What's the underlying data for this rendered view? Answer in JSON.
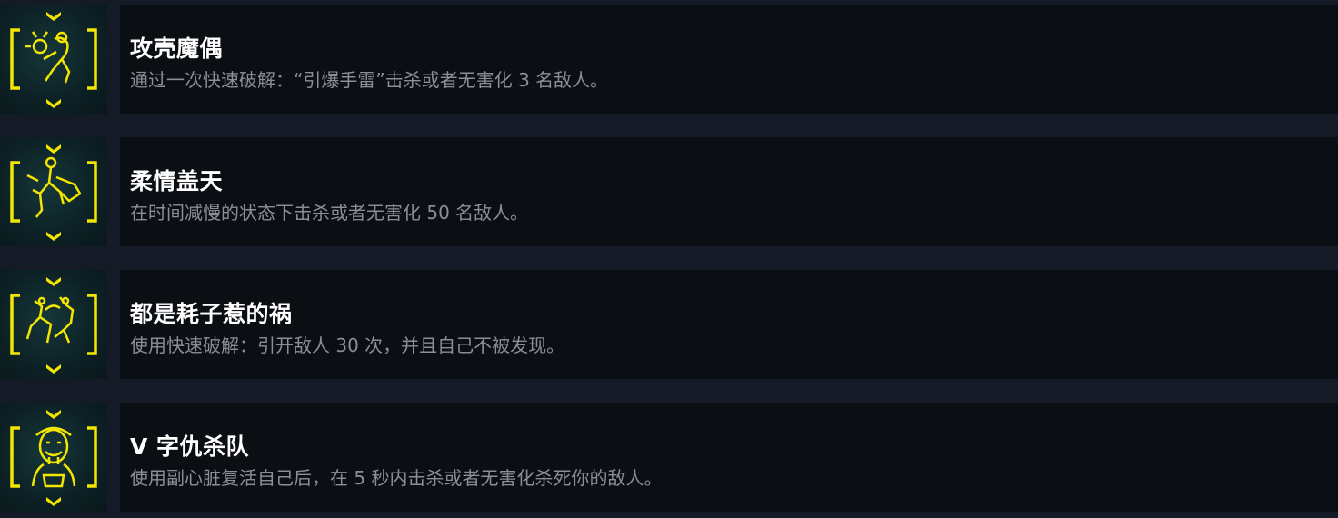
{
  "achievements": [
    {
      "title": "攻壳魔偶",
      "description": "通过一次快速破解：“引爆手雷”击杀或者无害化 3 名敌人。",
      "icon": "grenade-puppet-icon"
    },
    {
      "title": "柔情盖天",
      "description": "在时间减慢的状态下击杀或者无害化 50 名敌人。",
      "icon": "leaping-fighter-icon"
    },
    {
      "title": "都是耗子惹的祸",
      "description": "使用快速破解：引开敌人 30 次，并且自己不被发现。",
      "icon": "rats-icon"
    },
    {
      "title": "V 字仇杀队",
      "description": "使用副心脏复活自己后，在 5 秒内击杀或者无害化杀死你的敌人。",
      "icon": "masked-man-icon"
    }
  ],
  "colors": {
    "icon_accent": "#f2e600",
    "title": "#ffffff",
    "description": "#8a8f96",
    "row_background": "#0b0e12",
    "page_background": "#141b26"
  }
}
